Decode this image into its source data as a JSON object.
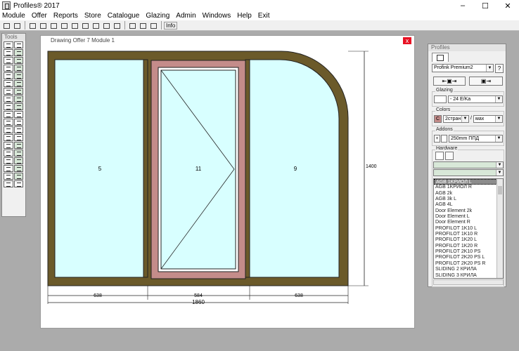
{
  "window": {
    "title": "Profiles® 2017",
    "min_icon": "minimize-icon",
    "max_icon": "maximize-icon",
    "close_icon": "close-icon"
  },
  "menu": [
    "Module",
    "Offer",
    "Reports",
    "Store",
    "Catalogue",
    "Glazing",
    "Admin",
    "Windows",
    "Help",
    "Exit"
  ],
  "toolbar": {
    "info_label": "Info"
  },
  "tools": {
    "title": "Tools"
  },
  "drawing": {
    "title": "Drawing   Offer 7   Module 1",
    "close_label": "x",
    "panels": [
      {
        "id": "left",
        "label": "5"
      },
      {
        "id": "middle",
        "label": "11"
      },
      {
        "id": "right",
        "label": "9"
      }
    ],
    "dims": {
      "height": "1400",
      "left": "638",
      "middle": "584",
      "right": "638",
      "total": "1860"
    },
    "colors": {
      "frame": "#6b5a2a",
      "sash": "#c48c8a",
      "glass": "#d8ffff"
    }
  },
  "profiles": {
    "title": "Profiles",
    "system_value": "Profink Premium2",
    "help_label": "?",
    "glazing_label": "Glazing",
    "glazing_value": "- 24 E/Ka",
    "colors_label": "Colors",
    "color_code": "C",
    "color_inner": "2стран",
    "color_sep": "/",
    "color_outer": "мах",
    "addons_label": "Addons",
    "addons_value": "250mm ППД",
    "hardware_label": "Hardware",
    "hardware_items": [
      "AGB 1KРИОЛ L",
      "AGB 1KРИОЛ R",
      "AGB 2k",
      "AGB 3k L",
      "AGB 4L",
      "Door Element 2k",
      "Door Element L",
      "Door Element R",
      "PROFILOT 1K10 L",
      "PROFILOT 1K10 R",
      "PROFILOT 1K20 L",
      "PROFILOT 1K20 R",
      "PROFILOT 2K10 PS",
      "PROFILOT 2K20 PS L",
      "PROFILOT 2K20 PS R",
      "SLIDING 2 КРИЛА",
      "SLIDING 3 КРИЛА"
    ]
  }
}
